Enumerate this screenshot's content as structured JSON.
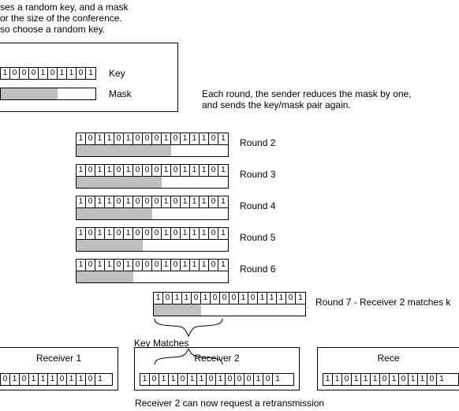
{
  "intro": {
    "line1": "ses a random key, and a mask",
    "line2": "or the size of the conference.",
    "line3": "so choose a random key."
  },
  "sender": {
    "key_bits": [
      "1",
      "0",
      "0",
      "0",
      "1",
      "0",
      "1",
      "1",
      "0",
      "1"
    ],
    "key_label": "Key",
    "mask_label": "Mask",
    "mask_filled": 6,
    "mask_total": 10
  },
  "explain": {
    "line1": "Each round, the sender reduces the mask by one,",
    "line2": "and sends the key/mask pair again."
  },
  "rounds": [
    {
      "bits": [
        "1",
        "0",
        "1",
        "1",
        "0",
        "1",
        "0",
        "0",
        "0",
        "1",
        "0",
        "1",
        "1",
        "1",
        "0",
        "1"
      ],
      "mask_filled": 10,
      "mask_total": 16,
      "label": "Round 2"
    },
    {
      "bits": [
        "1",
        "0",
        "1",
        "1",
        "0",
        "1",
        "0",
        "0",
        "0",
        "1",
        "0",
        "1",
        "1",
        "1",
        "0",
        "1"
      ],
      "mask_filled": 9,
      "mask_total": 16,
      "label": "Round 3"
    },
    {
      "bits": [
        "1",
        "0",
        "1",
        "1",
        "0",
        "1",
        "0",
        "0",
        "0",
        "1",
        "0",
        "1",
        "1",
        "1",
        "0",
        "1"
      ],
      "mask_filled": 8,
      "mask_total": 16,
      "label": "Round 4"
    },
    {
      "bits": [
        "1",
        "0",
        "1",
        "1",
        "0",
        "1",
        "0",
        "0",
        "0",
        "1",
        "0",
        "1",
        "1",
        "1",
        "0",
        "1"
      ],
      "mask_filled": 7,
      "mask_total": 16,
      "label": "Round 5"
    },
    {
      "bits": [
        "1",
        "0",
        "1",
        "1",
        "0",
        "1",
        "0",
        "0",
        "0",
        "1",
        "0",
        "1",
        "1",
        "1",
        "0",
        "1"
      ],
      "mask_filled": 6,
      "mask_total": 16,
      "label": "Round 6"
    }
  ],
  "round7": {
    "bits": [
      "1",
      "0",
      "1",
      "1",
      "0",
      "1",
      "0",
      "0",
      "0",
      "1",
      "0",
      "1",
      "1",
      "1",
      "0",
      "1"
    ],
    "mask_filled": 5,
    "mask_total": 16,
    "label": "Round 7 - Receiver 2 matches k"
  },
  "keymatches_label": "Key Matches",
  "receivers": [
    {
      "title": "Receiver 1",
      "bits": [
        "0",
        "1",
        "0",
        "1",
        "1",
        "1",
        "0",
        "1",
        "1",
        "0",
        "1"
      ]
    },
    {
      "title": "Receiver 2",
      "bits": [
        "1",
        "0",
        "1",
        "1",
        "0",
        "1",
        "1",
        "0",
        "1",
        "0",
        "0",
        "0",
        "1",
        "0",
        "1"
      ]
    },
    {
      "title": "Rece",
      "bits": [
        "1",
        "1",
        "0",
        "1",
        "1",
        "1",
        "0",
        "1",
        "0",
        "1",
        "1",
        "0",
        "1"
      ]
    }
  ],
  "caption": "Receiver 2 can now request a retransmission"
}
